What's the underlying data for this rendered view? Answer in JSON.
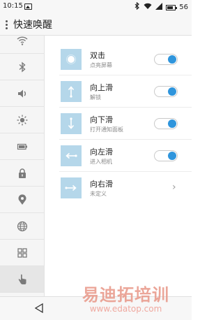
{
  "status_bar": {
    "time": "10:15",
    "battery": "56"
  },
  "app_bar": {
    "title": "快速唤醒"
  },
  "sidebar": {
    "items": [
      {
        "icon": "wifi-icon"
      },
      {
        "icon": "bluetooth-icon"
      },
      {
        "icon": "volume-icon"
      },
      {
        "icon": "brightness-icon"
      },
      {
        "icon": "battery-icon"
      },
      {
        "icon": "lock-icon"
      },
      {
        "icon": "location-icon"
      },
      {
        "icon": "globe-icon"
      },
      {
        "icon": "grid-icon"
      },
      {
        "icon": "gesture-hand-icon",
        "selected": true
      },
      {
        "icon": "info-icon"
      }
    ]
  },
  "gestures": [
    {
      "label": "双击",
      "sub": "点亮屏幕",
      "enabled": true,
      "icon": "double-tap-icon"
    },
    {
      "label": "向上滑",
      "sub": "解锁",
      "enabled": true,
      "icon": "swipe-up-icon"
    },
    {
      "label": "向下滑",
      "sub": "打开通知面板",
      "enabled": true,
      "icon": "swipe-down-icon"
    },
    {
      "label": "向左滑",
      "sub": "进入相机",
      "enabled": true,
      "icon": "swipe-left-icon"
    },
    {
      "label": "向右滑",
      "sub": "未定义",
      "enabled": false,
      "icon": "swipe-right-icon"
    }
  ],
  "colors": {
    "accent": "#2f95dc",
    "thumb_bg": "#b5d7ea"
  },
  "watermark": {
    "main": "易迪拓培训",
    "url": "www.edatop.com"
  }
}
